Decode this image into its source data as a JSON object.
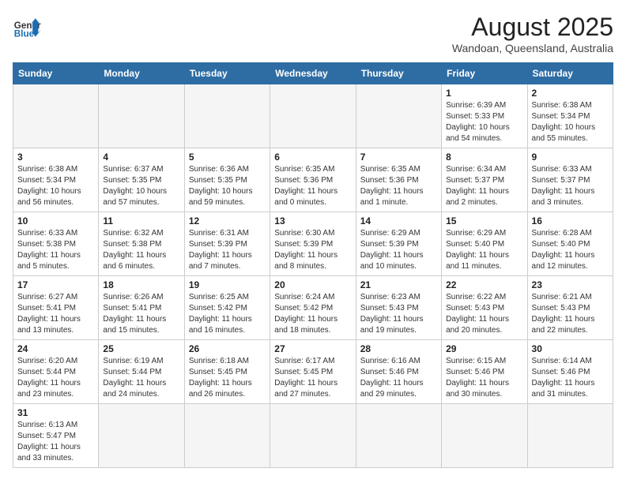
{
  "header": {
    "logo_text_general": "General",
    "logo_text_blue": "Blue",
    "title": "August 2025",
    "subtitle": "Wandoan, Queensland, Australia"
  },
  "days_of_week": [
    "Sunday",
    "Monday",
    "Tuesday",
    "Wednesday",
    "Thursday",
    "Friday",
    "Saturday"
  ],
  "weeks": [
    [
      {
        "day": "",
        "info": ""
      },
      {
        "day": "",
        "info": ""
      },
      {
        "day": "",
        "info": ""
      },
      {
        "day": "",
        "info": ""
      },
      {
        "day": "",
        "info": ""
      },
      {
        "day": "1",
        "info": "Sunrise: 6:39 AM\nSunset: 5:33 PM\nDaylight: 10 hours and 54 minutes."
      },
      {
        "day": "2",
        "info": "Sunrise: 6:38 AM\nSunset: 5:34 PM\nDaylight: 10 hours and 55 minutes."
      }
    ],
    [
      {
        "day": "3",
        "info": "Sunrise: 6:38 AM\nSunset: 5:34 PM\nDaylight: 10 hours and 56 minutes."
      },
      {
        "day": "4",
        "info": "Sunrise: 6:37 AM\nSunset: 5:35 PM\nDaylight: 10 hours and 57 minutes."
      },
      {
        "day": "5",
        "info": "Sunrise: 6:36 AM\nSunset: 5:35 PM\nDaylight: 10 hours and 59 minutes."
      },
      {
        "day": "6",
        "info": "Sunrise: 6:35 AM\nSunset: 5:36 PM\nDaylight: 11 hours and 0 minutes."
      },
      {
        "day": "7",
        "info": "Sunrise: 6:35 AM\nSunset: 5:36 PM\nDaylight: 11 hours and 1 minute."
      },
      {
        "day": "8",
        "info": "Sunrise: 6:34 AM\nSunset: 5:37 PM\nDaylight: 11 hours and 2 minutes."
      },
      {
        "day": "9",
        "info": "Sunrise: 6:33 AM\nSunset: 5:37 PM\nDaylight: 11 hours and 3 minutes."
      }
    ],
    [
      {
        "day": "10",
        "info": "Sunrise: 6:33 AM\nSunset: 5:38 PM\nDaylight: 11 hours and 5 minutes."
      },
      {
        "day": "11",
        "info": "Sunrise: 6:32 AM\nSunset: 5:38 PM\nDaylight: 11 hours and 6 minutes."
      },
      {
        "day": "12",
        "info": "Sunrise: 6:31 AM\nSunset: 5:39 PM\nDaylight: 11 hours and 7 minutes."
      },
      {
        "day": "13",
        "info": "Sunrise: 6:30 AM\nSunset: 5:39 PM\nDaylight: 11 hours and 8 minutes."
      },
      {
        "day": "14",
        "info": "Sunrise: 6:29 AM\nSunset: 5:39 PM\nDaylight: 11 hours and 10 minutes."
      },
      {
        "day": "15",
        "info": "Sunrise: 6:29 AM\nSunset: 5:40 PM\nDaylight: 11 hours and 11 minutes."
      },
      {
        "day": "16",
        "info": "Sunrise: 6:28 AM\nSunset: 5:40 PM\nDaylight: 11 hours and 12 minutes."
      }
    ],
    [
      {
        "day": "17",
        "info": "Sunrise: 6:27 AM\nSunset: 5:41 PM\nDaylight: 11 hours and 13 minutes."
      },
      {
        "day": "18",
        "info": "Sunrise: 6:26 AM\nSunset: 5:41 PM\nDaylight: 11 hours and 15 minutes."
      },
      {
        "day": "19",
        "info": "Sunrise: 6:25 AM\nSunset: 5:42 PM\nDaylight: 11 hours and 16 minutes."
      },
      {
        "day": "20",
        "info": "Sunrise: 6:24 AM\nSunset: 5:42 PM\nDaylight: 11 hours and 18 minutes."
      },
      {
        "day": "21",
        "info": "Sunrise: 6:23 AM\nSunset: 5:43 PM\nDaylight: 11 hours and 19 minutes."
      },
      {
        "day": "22",
        "info": "Sunrise: 6:22 AM\nSunset: 5:43 PM\nDaylight: 11 hours and 20 minutes."
      },
      {
        "day": "23",
        "info": "Sunrise: 6:21 AM\nSunset: 5:43 PM\nDaylight: 11 hours and 22 minutes."
      }
    ],
    [
      {
        "day": "24",
        "info": "Sunrise: 6:20 AM\nSunset: 5:44 PM\nDaylight: 11 hours and 23 minutes."
      },
      {
        "day": "25",
        "info": "Sunrise: 6:19 AM\nSunset: 5:44 PM\nDaylight: 11 hours and 24 minutes."
      },
      {
        "day": "26",
        "info": "Sunrise: 6:18 AM\nSunset: 5:45 PM\nDaylight: 11 hours and 26 minutes."
      },
      {
        "day": "27",
        "info": "Sunrise: 6:17 AM\nSunset: 5:45 PM\nDaylight: 11 hours and 27 minutes."
      },
      {
        "day": "28",
        "info": "Sunrise: 6:16 AM\nSunset: 5:46 PM\nDaylight: 11 hours and 29 minutes."
      },
      {
        "day": "29",
        "info": "Sunrise: 6:15 AM\nSunset: 5:46 PM\nDaylight: 11 hours and 30 minutes."
      },
      {
        "day": "30",
        "info": "Sunrise: 6:14 AM\nSunset: 5:46 PM\nDaylight: 11 hours and 31 minutes."
      }
    ],
    [
      {
        "day": "31",
        "info": "Sunrise: 6:13 AM\nSunset: 5:47 PM\nDaylight: 11 hours and 33 minutes."
      },
      {
        "day": "",
        "info": ""
      },
      {
        "day": "",
        "info": ""
      },
      {
        "day": "",
        "info": ""
      },
      {
        "day": "",
        "info": ""
      },
      {
        "day": "",
        "info": ""
      },
      {
        "day": "",
        "info": ""
      }
    ]
  ]
}
